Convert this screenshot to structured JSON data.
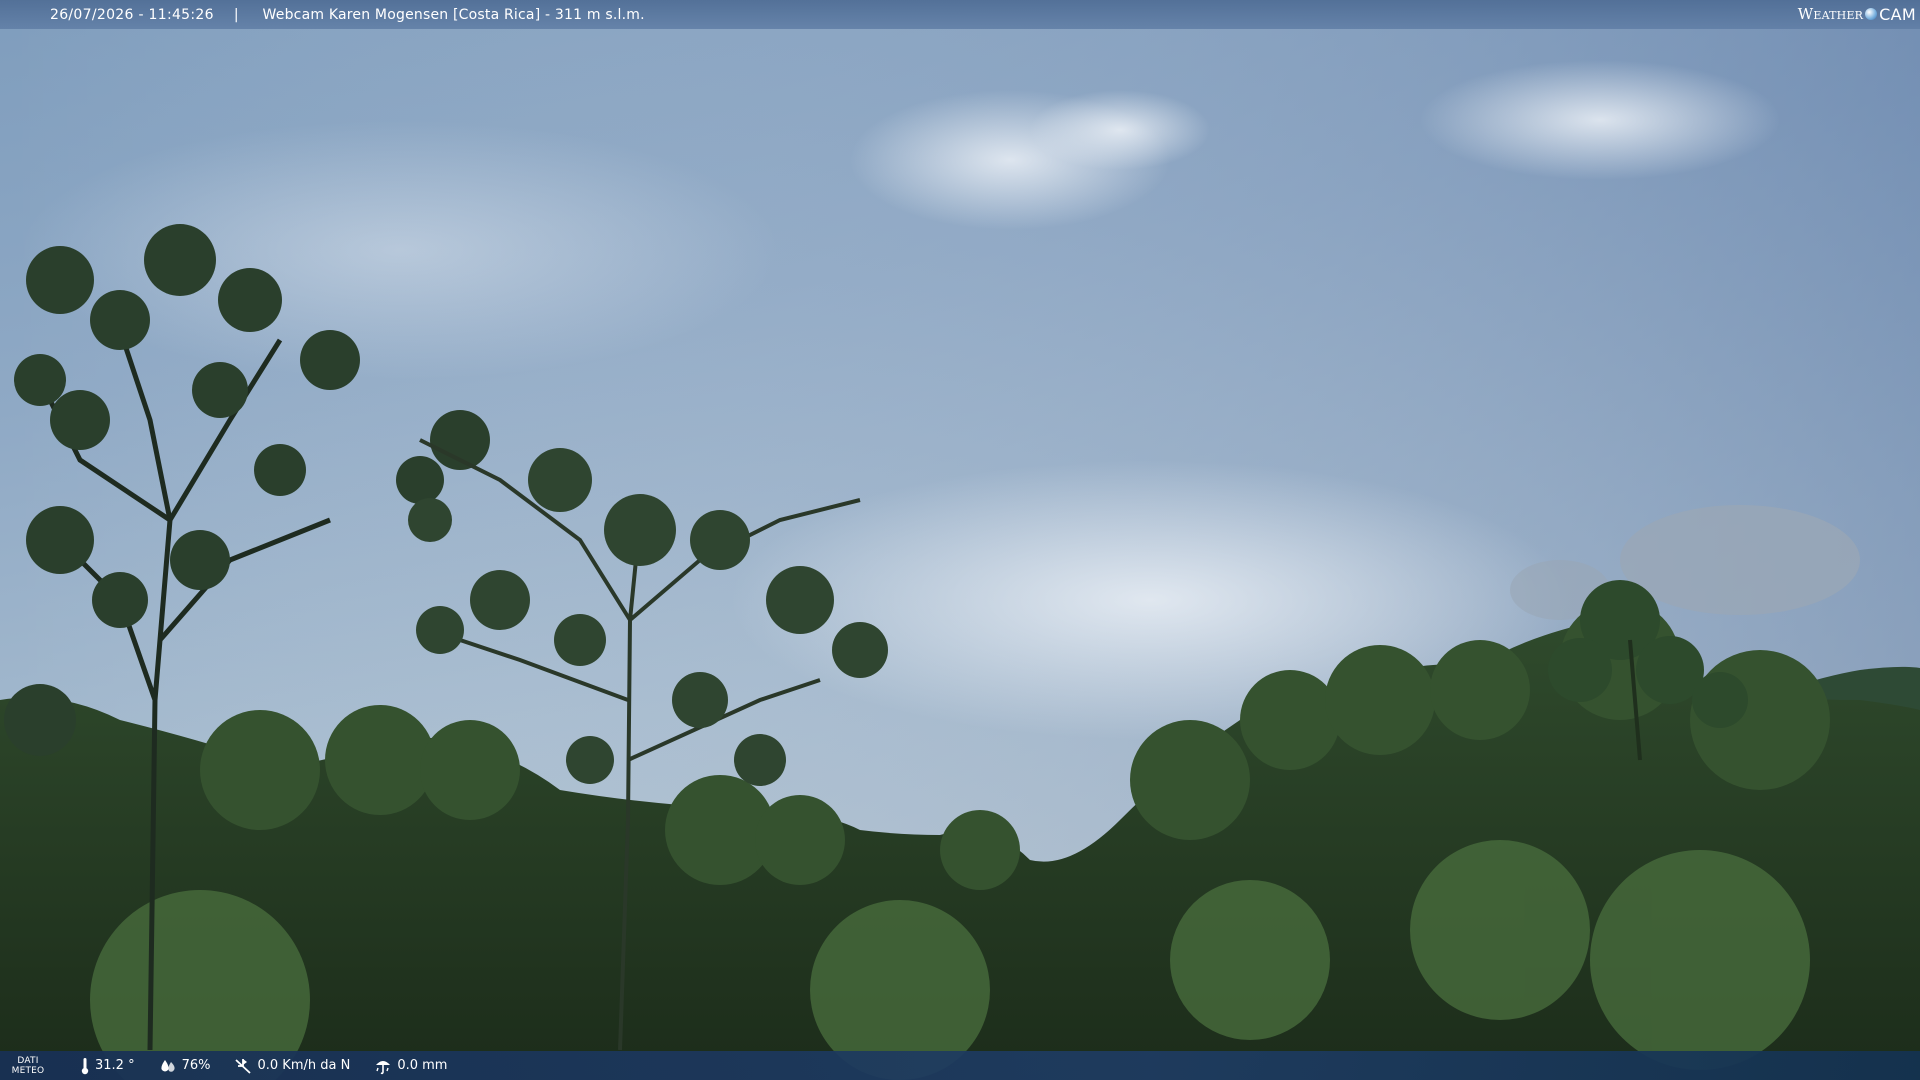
{
  "header": {
    "datetime": "26/07/2026 - 11:45:26",
    "separator": "|",
    "title": "Webcam Karen Mogensen [Costa Rica]  - 311 m s.l.m."
  },
  "brand": {
    "weather": "Weather",
    "cam": "CAM"
  },
  "footer": {
    "label_line1": "DATI",
    "label_line2": "METEO",
    "temperature": "31.2 °",
    "humidity": "76%",
    "wind": "0.0 Km/h da N",
    "rain": "0.0 mm"
  },
  "icons": {
    "temperature": "thermometer-icon",
    "humidity": "humidity-drop-icon",
    "wind": "wind-icon",
    "rain": "rain-gauge-icon"
  }
}
